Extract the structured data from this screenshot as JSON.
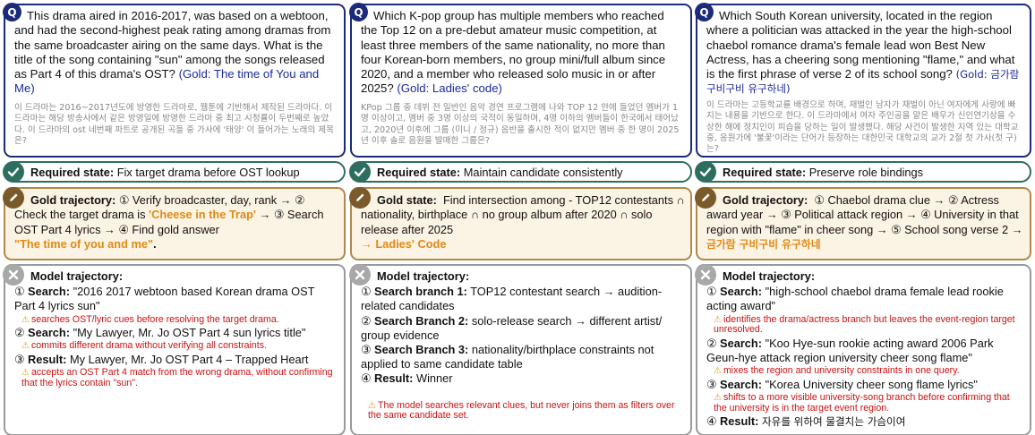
{
  "columns": [
    {
      "question": "This drama aired in 2016-2017, was based on a webtoon, and had the second-highest peak rating among dramas from the same broadcaster airing on the same days. What is the title of the song containing \"sun\" among the songs released as Part 4 of this drama's OST?",
      "question_gold": "(Gold: The time of You and Me)",
      "question_ko": "이 드라마는 2016~2017년도에 방영한 드라마로, 웹툰에 기반해서 제작된 드라마다. 이 드라마는 해당 방송사에서 같은 방영일에 방영한 드라마 중 최고 시청률이 두번째로 높았다. 이 드라마의 ost 네번째 파트로 공개된 곡들 중 가사에 '태양' 이 들어가는 노래의 제목은?",
      "required_label": "Required state:",
      "required_text": "Fix target drama before OST lookup",
      "gold_label": "Gold trajectory:",
      "gold_text": "① Verify broadcaster, day, rank → ② Check the target drama is",
      "gold_accent1": "'Cheese in the Trap'",
      "gold_text2": "→ ③ Search OST Part 4 lyrics → ④ Find gold answer",
      "gold_accent2": "\"The time of you and me\"",
      "gold_end": ".",
      "model_label": "Model trajectory:",
      "s1_label": "Search:",
      "s1_text": "\"2016 2017 webtoon based Korean drama OST Part 4 lyrics sun\"",
      "w1": "searches OST/lyric cues before resolving the target drama.",
      "s2_label": "Search:",
      "s2_text": "\"My Lawyer, Mr. Jo OST Part 4 sun lyrics title\"",
      "w2": "commits different drama without verifying all constraints.",
      "s3_label": "Result:",
      "s3_text": "My Lawyer, Mr. Jo OST Part 4 – Trapped Heart",
      "w3": "accepts an OST Part 4 match from the wrong drama, without confirming that the lyrics contain \"sun\"."
    },
    {
      "question": "Which K-pop group has multiple members who reached the Top 12 on a pre-debut amateur music competition, at least three members of the same nationality, no more than four Korean-born members, no group mini/full album since 2020, and a member who released solo music in or after 2025?",
      "question_gold": "(Gold: Ladies' code)",
      "question_ko": "KPop 그룹 중 데뷔 전 일반인 음악 경연 프로그램에 나와 TOP 12 안에 들었던 멤버가 1명 이상이고, 멤버 중 3명 이상의 국적이 동일하며, 4명 이하의 멤버들이 한국에서 태어났고, 2020년 이후에 그룹 (미니 / 정규) 음반을 출시한 적이 없지만 멤버 중 한 명이 2025년 이후 솔로 음원을 발매한 그룹은?",
      "required_label": "Required state:",
      "required_text": "Maintain candidate consistently",
      "gold_label": "Gold state:",
      "gold_text": "Find intersection among - TOP12 contestants ∩ nationality, birthplace ∩ no group album after 2020 ∩ solo release after 2025",
      "gold_arrow": "→",
      "gold_accent1": "Ladies' Code",
      "model_label": "Model trajectory:",
      "s1_label": "Search branch 1:",
      "s1_text": "TOP12 contestant search → audition-related candidates",
      "s2_label": "Search Branch 2:",
      "s2_text": "solo-release search → different artist/ group evidence",
      "s3_label": "Search Branch 3:",
      "s3_text": "nationality/birthplace constraints not applied to same candidate table",
      "s4_label": "Result:",
      "s4_text": "Winner",
      "w1": "The model searches relevant clues, but never joins them as filters over the same candidate set."
    },
    {
      "question": "Which South Korean university, located in the region where a politician was attacked in the year the high-school chaebol romance drama's female lead won Best New Actress, has a cheering song mentioning \"flame,\" and what is the first phrase of verse 2 of its school song?",
      "question_gold": "(Gold: 금가람 구비구비 유구하네)",
      "question_ko": "이 드라마는 고등학교를 배경으로 하며, 재벌인 남자가 재벌이 아닌 여자에게 사랑에 빠지는 내용을 기반으로 한다. 이 드라마에서 여자 주인공을 맡은 배우가 신인연기상을 수상한 해에 정치인이 피습을 당하는 일이 발생했다. 해당 사건이 발생한 지역 있는 대학교 중, 응원가에 '불꽃'이라는 단어가 등장하는 대한민국 대학교의 교가 2절 첫 가사(첫 구)는?",
      "required_label": "Required state:",
      "required_text": "Preserve role bindings",
      "gold_label": "Gold trajectory:",
      "gold_text": "① Chaebol drama clue → ② Actress award year → ③ Political attack region → ④ University in that region with \"flame\" in cheer song → ⑤ School song verse 2 →",
      "gold_accent1": "금가람 구비구비 유구하네",
      "model_label": "Model trajectory:",
      "s1_label": "Search:",
      "s1_text": "\"high-school chaebol drama female lead rookie acting award\"",
      "w1": "identifies the drama/actress branch but leaves the event-region target unresolved.",
      "s2_label": "Search:",
      "s2_text": "\"Koo Hye-sun rookie acting award 2006 Park Geun-hye attack region university cheer song flame\"",
      "w2": "mixes the region and university constraints in one query.",
      "s3_label": "Search:",
      "s3_text": "\"Korea University cheer song flame lyrics\"",
      "w3": "shifts to a more visible university-song branch before confirming that the university is in the target event region.",
      "s4_label": "Result:",
      "s4_text": "자유를 위하여 물결치는 가슴이여"
    }
  ],
  "icons": {
    "question": "question-badge-icon",
    "required": "check-circle-icon",
    "gold": "pencil-icon",
    "model": "x-circle-icon",
    "warning": "warning-triangle-icon"
  },
  "circled_numbers": {
    "n1": "①",
    "n2": "②",
    "n3": "③",
    "n4": "④"
  },
  "badge_q": "Q",
  "warn_glyph": "⚠",
  "colors": {
    "question_border": "#1b2a7a",
    "required_border": "#2e6e60",
    "gold_border": "#b0894a",
    "gold_fill": "#fbf3e4",
    "model_border": "#9a9a9a",
    "accent": "#e08a16",
    "warning": "#cc1111"
  }
}
